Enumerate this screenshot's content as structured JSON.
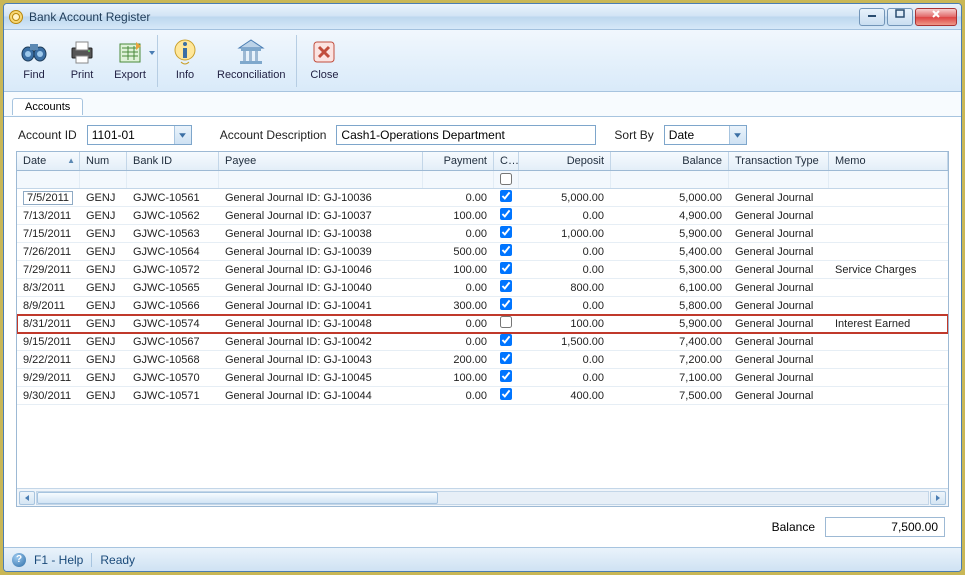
{
  "window": {
    "title": "Bank Account Register"
  },
  "toolbar": {
    "find": "Find",
    "print": "Print",
    "export": "Export",
    "info": "Info",
    "reconciliation": "Reconciliation",
    "close": "Close"
  },
  "tab": {
    "accounts": "Accounts"
  },
  "filters": {
    "account_id_label": "Account ID",
    "account_id_value": "1101-01",
    "desc_label": "Account Description",
    "desc_value": "Cash1-Operations Department",
    "sortby_label": "Sort By",
    "sortby_value": "Date"
  },
  "columns": {
    "date": "Date",
    "num": "Num",
    "bankid": "Bank ID",
    "payee": "Payee",
    "payment": "Payment",
    "clr": "Clr",
    "deposit": "Deposit",
    "balance": "Balance",
    "ttype": "Transaction Type",
    "memo": "Memo"
  },
  "rows": [
    {
      "date": "7/5/2011",
      "num": "GENJ",
      "bankid": "GJWC-10561",
      "payee": "General Journal ID: GJ-10036",
      "payment": "0.00",
      "clr": true,
      "deposit": "5,000.00",
      "balance": "5,000.00",
      "ttype": "General Journal",
      "memo": "",
      "hl": false,
      "datebox": true
    },
    {
      "date": "7/13/2011",
      "num": "GENJ",
      "bankid": "GJWC-10562",
      "payee": "General Journal ID: GJ-10037",
      "payment": "100.00",
      "clr": true,
      "deposit": "0.00",
      "balance": "4,900.00",
      "ttype": "General Journal",
      "memo": "",
      "hl": false
    },
    {
      "date": "7/15/2011",
      "num": "GENJ",
      "bankid": "GJWC-10563",
      "payee": "General Journal ID: GJ-10038",
      "payment": "0.00",
      "clr": true,
      "deposit": "1,000.00",
      "balance": "5,900.00",
      "ttype": "General Journal",
      "memo": "",
      "hl": false
    },
    {
      "date": "7/26/2011",
      "num": "GENJ",
      "bankid": "GJWC-10564",
      "payee": "General Journal ID: GJ-10039",
      "payment": "500.00",
      "clr": true,
      "deposit": "0.00",
      "balance": "5,400.00",
      "ttype": "General Journal",
      "memo": "",
      "hl": false
    },
    {
      "date": "7/29/2011",
      "num": "GENJ",
      "bankid": "GJWC-10572",
      "payee": "General Journal ID: GJ-10046",
      "payment": "100.00",
      "clr": true,
      "deposit": "0.00",
      "balance": "5,300.00",
      "ttype": "General Journal",
      "memo": "Service Charges",
      "hl": false
    },
    {
      "date": "8/3/2011",
      "num": "GENJ",
      "bankid": "GJWC-10565",
      "payee": "General Journal ID: GJ-10040",
      "payment": "0.00",
      "clr": true,
      "deposit": "800.00",
      "balance": "6,100.00",
      "ttype": "General Journal",
      "memo": "",
      "hl": false
    },
    {
      "date": "8/9/2011",
      "num": "GENJ",
      "bankid": "GJWC-10566",
      "payee": "General Journal ID: GJ-10041",
      "payment": "300.00",
      "clr": true,
      "deposit": "0.00",
      "balance": "5,800.00",
      "ttype": "General Journal",
      "memo": "",
      "hl": false
    },
    {
      "date": "8/31/2011",
      "num": "GENJ",
      "bankid": "GJWC-10574",
      "payee": "General Journal ID: GJ-10048",
      "payment": "0.00",
      "clr": false,
      "deposit": "100.00",
      "balance": "5,900.00",
      "ttype": "General Journal",
      "memo": "Interest Earned",
      "hl": true
    },
    {
      "date": "9/15/2011",
      "num": "GENJ",
      "bankid": "GJWC-10567",
      "payee": "General Journal ID: GJ-10042",
      "payment": "0.00",
      "clr": true,
      "deposit": "1,500.00",
      "balance": "7,400.00",
      "ttype": "General Journal",
      "memo": "",
      "hl": false
    },
    {
      "date": "9/22/2011",
      "num": "GENJ",
      "bankid": "GJWC-10568",
      "payee": "General Journal ID: GJ-10043",
      "payment": "200.00",
      "clr": true,
      "deposit": "0.00",
      "balance": "7,200.00",
      "ttype": "General Journal",
      "memo": "",
      "hl": false
    },
    {
      "date": "9/29/2011",
      "num": "GENJ",
      "bankid": "GJWC-10570",
      "payee": "General Journal ID: GJ-10045",
      "payment": "100.00",
      "clr": true,
      "deposit": "0.00",
      "balance": "7,100.00",
      "ttype": "General Journal",
      "memo": "",
      "hl": false
    },
    {
      "date": "9/30/2011",
      "num": "GENJ",
      "bankid": "GJWC-10571",
      "payee": "General Journal ID: GJ-10044",
      "payment": "0.00",
      "clr": true,
      "deposit": "400.00",
      "balance": "7,500.00",
      "ttype": "General Journal",
      "memo": "",
      "hl": false
    }
  ],
  "footer": {
    "balance_label": "Balance",
    "balance_value": "7,500.00"
  },
  "status": {
    "help": "F1 - Help",
    "ready": "Ready"
  }
}
